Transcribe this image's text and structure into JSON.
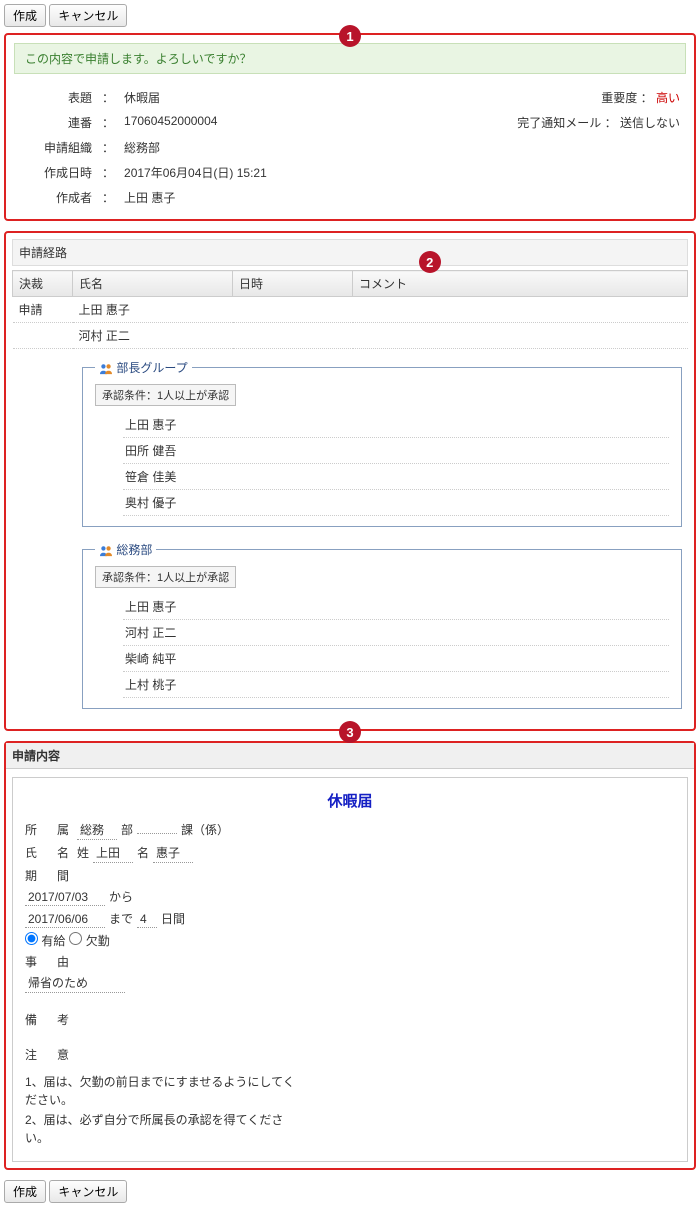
{
  "toolbar": {
    "create": "作成",
    "cancel": "キャンセル"
  },
  "confirm_message": "この内容で申請します。よろしいですか？",
  "meta": {
    "labels": {
      "subject": "表題",
      "serial": "連番",
      "org": "申請組織",
      "created_at": "作成日時",
      "creator": "作成者",
      "importance": "重要度",
      "notify": "完了通知メール"
    },
    "subject": "休暇届",
    "serial": "17060452000004",
    "org": "総務部",
    "created_at": "2017年06月04日(日) 15:21",
    "creator": "上田 惠子",
    "importance": "高い",
    "notify": "送信しない"
  },
  "route": {
    "title": "申請経路",
    "headers": {
      "decision": "決裁",
      "name": "氏名",
      "datetime": "日時",
      "comment": "コメント"
    },
    "apply_label": "申請",
    "applicants": [
      "上田 惠子",
      "河村 正二"
    ],
    "cond_prefix": "承認条件：",
    "groups": [
      {
        "name": "部長グループ",
        "condition": "1人以上が承認",
        "members": [
          "上田 惠子",
          "田所 健吾",
          "笹倉 佳美",
          "奥村 優子"
        ]
      },
      {
        "name": "総務部",
        "condition": "1人以上が承認",
        "members": [
          "上田 惠子",
          "河村 正二",
          "柴崎 純平",
          "上村 桃子"
        ]
      }
    ]
  },
  "content": {
    "section_title": "申請内容",
    "form_title": "休暇届",
    "labels": {
      "affiliation": "所　属",
      "bu_suffix": "部",
      "ka_suffix": "課（係）",
      "name": "氏　名",
      "surname_prefix": "姓",
      "given_prefix": "名",
      "period": "期　間",
      "from_suffix": "から",
      "to_suffix": "まで",
      "days_suffix": "日間",
      "paid": "有給",
      "absent": "欠勤",
      "reason": "事　由",
      "remarks": "備　考",
      "notes": "注　意"
    },
    "affiliation_bu": "総務",
    "affiliation_ka": "",
    "surname": "上田",
    "given": "惠子",
    "date_from": "2017/07/03",
    "date_to": "2017/06/06",
    "days": "4",
    "leave_type": "paid",
    "reason": "帰省のため",
    "remarks": "",
    "note1": "1、届は、欠勤の前日までにすませるようにしてください。",
    "note2": "2、届は、必ず自分で所属長の承認を得てください。"
  },
  "badges": {
    "b1": "1",
    "b2": "2",
    "b3": "3"
  }
}
